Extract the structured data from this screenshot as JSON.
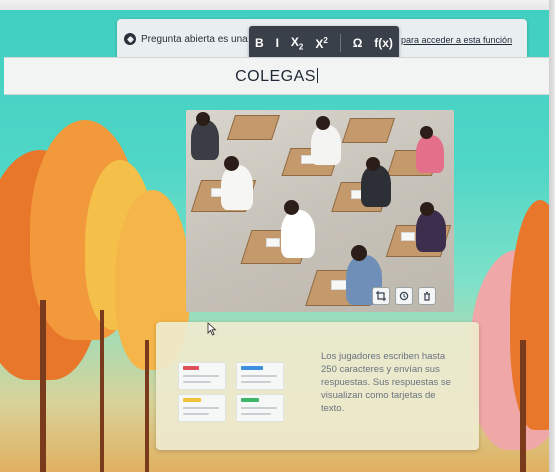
{
  "notice": {
    "text": "Pregunta abierta es una",
    "link_text": "para acceder a esta función"
  },
  "format_toolbar": {
    "bold": "B",
    "italic": "I",
    "subscript_base": "X",
    "subscript_mark": "2",
    "superscript_base": "X",
    "superscript_mark": "2",
    "special_char": "Ω",
    "formula": "f(x)"
  },
  "question": {
    "title": "COLEGAS"
  },
  "image_actions": [
    "crop-icon",
    "replace-icon",
    "delete-icon"
  ],
  "info_card": {
    "description": "Los jugadores escriben hasta 250 caracteres y envían sus respuestas. Sus respuestas se visualizan como tarjetas de texto."
  },
  "colors": {
    "background_teal": "#4fd6c6",
    "toolbar_dark": "#3a4049",
    "autumn_orange": "#e8772b"
  }
}
